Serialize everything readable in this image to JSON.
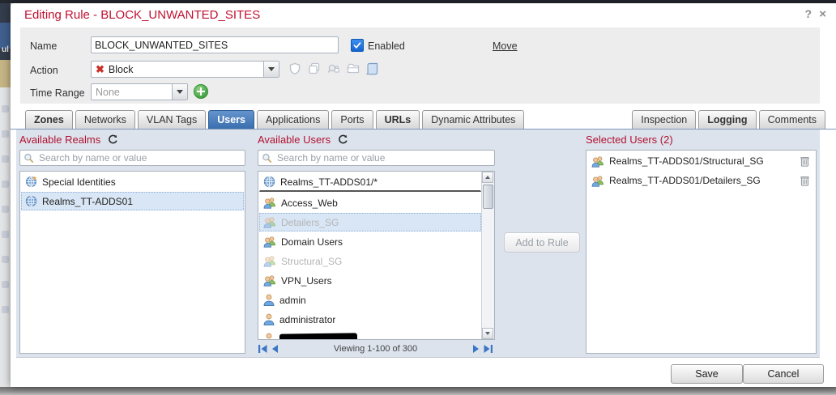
{
  "dialog": {
    "title": "Editing Rule - BLOCK_UNWANTED_SITES",
    "help_icon": "?",
    "close_icon": "×"
  },
  "form": {
    "name_label": "Name",
    "name_value": "BLOCK_UNWANTED_SITES",
    "enabled_label": "Enabled",
    "enabled_checked": true,
    "move_label": "Move",
    "action_label": "Action",
    "action_value": "Block",
    "action_icon": "block-x-icon",
    "action_icon_glyph": "✖",
    "time_range_label": "Time Range",
    "time_range_value": "None",
    "toolbar_icons": [
      "shield-icon",
      "copy-policy-icon",
      "inspect-lock-icon",
      "folder-icon",
      "logging-scroll-icon"
    ]
  },
  "tabs": {
    "left": [
      {
        "label": "Zones",
        "bold": true
      },
      {
        "label": "Networks"
      },
      {
        "label": "VLAN Tags"
      },
      {
        "label": "Users",
        "active": true,
        "bold": true
      },
      {
        "label": "Applications"
      },
      {
        "label": "Ports"
      },
      {
        "label": "URLs",
        "bold": true
      },
      {
        "label": "Dynamic Attributes"
      }
    ],
    "right": [
      {
        "label": "Inspection"
      },
      {
        "label": "Logging",
        "bold": true
      },
      {
        "label": "Comments"
      }
    ]
  },
  "users_tab": {
    "realms": {
      "header": "Available Realms",
      "refresh_icon": "refresh-icon",
      "search_placeholder": "Search by name or value",
      "items": [
        {
          "label": "Special Identities",
          "icon": "globe-special"
        },
        {
          "label": "Realms_TT-ADDS01",
          "icon": "globe",
          "selected": true
        }
      ]
    },
    "available_users": {
      "header": "Available Users",
      "refresh_icon": "refresh-icon",
      "search_placeholder": "Search by name or value",
      "items": [
        {
          "label": "Realms_TT-ADDS01/*",
          "icon": "globe",
          "divider": true
        },
        {
          "label": "Access_Web",
          "icon": "group"
        },
        {
          "label": "Detailers_SG",
          "icon": "group",
          "disabled": true,
          "selected": true
        },
        {
          "label": "Domain Users",
          "icon": "group"
        },
        {
          "label": "Structural_SG",
          "icon": "group",
          "disabled": true
        },
        {
          "label": "VPN_Users",
          "icon": "group"
        },
        {
          "label": "admin",
          "icon": "user"
        },
        {
          "label": "administrator",
          "icon": "user"
        },
        {
          "label": "",
          "icon": "user",
          "redacted": true
        }
      ],
      "paging_text": "Viewing 1-100 of 300"
    },
    "add_button_label": "Add to Rule",
    "selected_users": {
      "header": "Selected Users (2)",
      "items": [
        {
          "label": "Realms_TT-ADDS01/Structural_SG",
          "icon": "group",
          "delete_icon": "trash-icon"
        },
        {
          "label": "Realms_TT-ADDS01/Detailers_SG",
          "icon": "group",
          "delete_icon": "trash-icon"
        }
      ]
    }
  },
  "footer": {
    "save_label": "Save",
    "cancel_label": "Cancel"
  },
  "colors": {
    "title_red": "#c01031",
    "header_red": "#b2122f",
    "active_tab_blue": "#3a6fae",
    "content_bg": "#dce3ed",
    "selection_bg": "#d9e6f5",
    "enabled_checkbox_blue": "#1365cf",
    "add_plus_green": "#3fa244",
    "block_x_red": "#c9302c"
  }
}
